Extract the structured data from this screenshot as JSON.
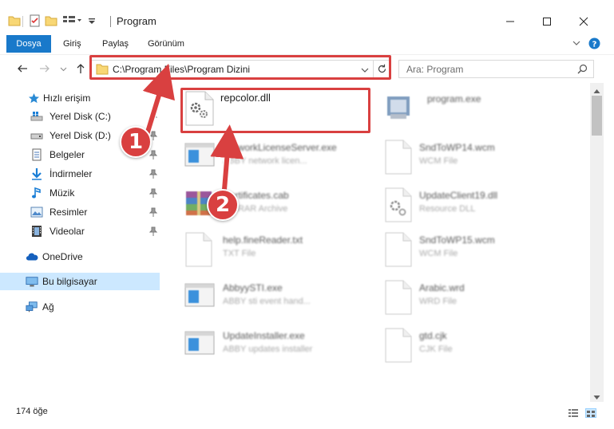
{
  "window": {
    "title": "Program",
    "minimize_glyph": "—",
    "maximize_glyph": "☐",
    "close_glyph": "✕"
  },
  "ribbon": {
    "tabs": [
      "Dosya",
      "Giriş",
      "Paylaş",
      "Görünüm"
    ],
    "accent": "#1979ca"
  },
  "navigation": {
    "address": "C:\\Program Files\\Program Dizini",
    "search_placeholder": "Ara: Program"
  },
  "sidebar": {
    "items": [
      {
        "label": "Hızlı erişim",
        "icon": "star-icon",
        "pinned": false
      },
      {
        "label": "Yerel Disk (C:)",
        "icon": "windows-drive-icon",
        "pinned": true
      },
      {
        "label": "Yerel Disk (D:)",
        "icon": "drive-icon",
        "pinned": true
      },
      {
        "label": "Belgeler",
        "icon": "documents-icon",
        "pinned": true
      },
      {
        "label": "İndirmeler",
        "icon": "downloads-icon",
        "pinned": true
      },
      {
        "label": "Müzik",
        "icon": "music-icon",
        "pinned": true
      },
      {
        "label": "Resimler",
        "icon": "pictures-icon",
        "pinned": true
      },
      {
        "label": "Videolar",
        "icon": "videos-icon",
        "pinned": true
      },
      {
        "label": "OneDrive",
        "icon": "cloud-icon",
        "pinned": false
      },
      {
        "label": "Bu bilgisayar",
        "icon": "computer-icon",
        "pinned": false
      },
      {
        "label": "Ağ",
        "icon": "network-icon",
        "pinned": false
      }
    ]
  },
  "files": [
    {
      "name": "repcolor.dll",
      "type": "",
      "icon": "dll-gear-icon"
    },
    {
      "name": "program.exe",
      "type": "",
      "icon": "exe-icon"
    },
    {
      "name": "NetworkLicenseServer.exe",
      "type": "ABBY network licen...",
      "icon": "app-window-icon"
    },
    {
      "name": "SndToWP14.wcm",
      "type": "WCM File",
      "icon": "blank-file-icon"
    },
    {
      "name": "Certificates.cab",
      "type": "WinRAR Archive",
      "icon": "archive-icon"
    },
    {
      "name": "UpdateClient19.dll",
      "type": "Resource DLL",
      "icon": "dll-gear-icon"
    },
    {
      "name": "help.fineReader.txt",
      "type": "TXT File",
      "icon": "blank-file-icon"
    },
    {
      "name": "SndToWP15.wcm",
      "type": "WCM File",
      "icon": "blank-file-icon"
    },
    {
      "name": "AbbyySTI.exe",
      "type": "ABBY sti event hand...",
      "icon": "app-window-icon"
    },
    {
      "name": "Arabic.wrd",
      "type": "WRD File",
      "icon": "blank-file-icon"
    },
    {
      "name": "UpdateInstaller.exe",
      "type": "ABBY updates installer",
      "icon": "app-window-icon"
    },
    {
      "name": "gtd.cjk",
      "type": "CJK File",
      "icon": "blank-file-icon"
    }
  ],
  "status": {
    "item_count": "174 öğe"
  },
  "steps": [
    "1",
    "2"
  ],
  "colors": {
    "highlight_red": "#d94040",
    "folder_yellow": "#f8d775",
    "selection_blue": "#cce8ff"
  }
}
